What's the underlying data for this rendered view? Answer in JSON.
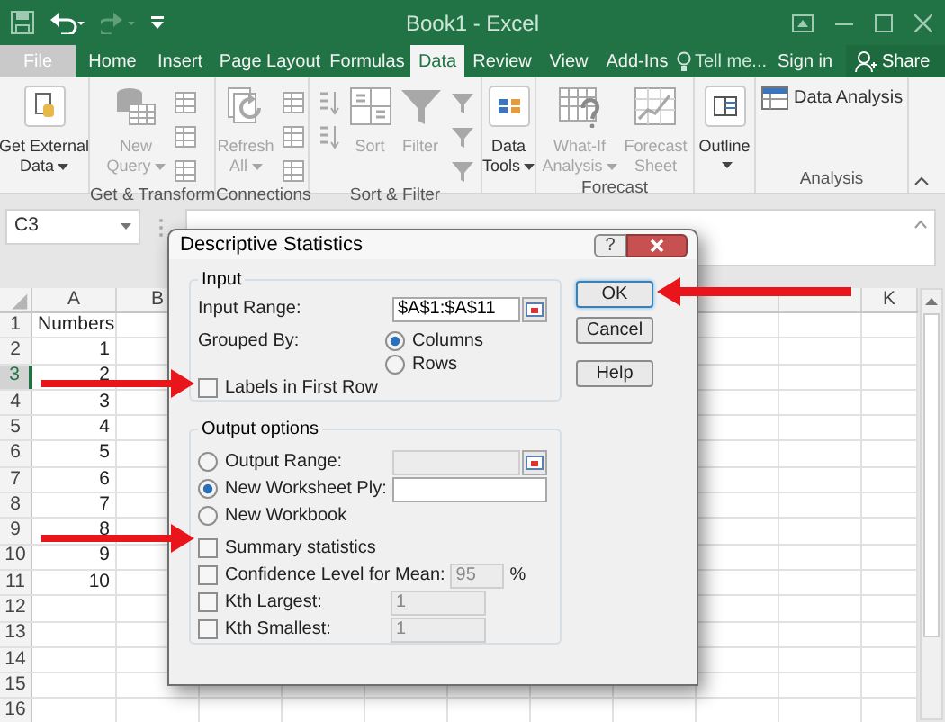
{
  "window": {
    "title": "Book1 - Excel"
  },
  "tabs": [
    {
      "label": "File",
      "selected": false,
      "kind": "file"
    },
    {
      "label": "Home",
      "selected": false
    },
    {
      "label": "Insert",
      "selected": false
    },
    {
      "label": "Page Layout",
      "selected": false
    },
    {
      "label": "Formulas",
      "selected": false
    },
    {
      "label": "Data",
      "selected": true
    },
    {
      "label": "Review",
      "selected": false
    },
    {
      "label": "View",
      "selected": false
    },
    {
      "label": "Add-Ins",
      "selected": false
    }
  ],
  "tell_me": "Tell me...",
  "sign_in": "Sign in",
  "share": "Share",
  "ribbon_groups": [
    {
      "buttons": [
        {
          "lines": [
            "Get External",
            "Data"
          ],
          "disabled": false,
          "dropdown": true
        }
      ]
    },
    {
      "label": "Get & Transform",
      "buttons": [
        {
          "lines": [
            "New",
            "Query"
          ],
          "disabled": true,
          "dropdown": true
        }
      ]
    },
    {
      "label": "Connections",
      "buttons": [
        {
          "lines": [
            "Refresh",
            "All"
          ],
          "disabled": true,
          "dropdown": true
        }
      ]
    },
    {
      "label": "Sort & Filter",
      "buttons": [
        {
          "lines": [
            "Sort"
          ],
          "disabled": true,
          "dropdown": false
        },
        {
          "lines": [
            "Filter"
          ],
          "disabled": true,
          "dropdown": false
        }
      ]
    },
    {
      "buttons": [
        {
          "lines": [
            "Data",
            "Tools"
          ],
          "disabled": false,
          "dropdown": true
        }
      ]
    },
    {
      "label": "Forecast",
      "buttons": [
        {
          "lines": [
            "What-If",
            "Analysis"
          ],
          "disabled": true,
          "dropdown": true
        },
        {
          "lines": [
            "Forecast",
            "Sheet"
          ],
          "disabled": true,
          "dropdown": false
        }
      ]
    },
    {
      "buttons": [
        {
          "lines": [
            "Outline"
          ],
          "disabled": false,
          "dropdown": true
        }
      ]
    },
    {
      "label": "Analysis",
      "buttons": [
        {
          "lines": [
            "Data Analysis"
          ],
          "disabled": false,
          "dropdown": false,
          "kind": "small"
        }
      ]
    }
  ],
  "sheet": {
    "name_box": "C3",
    "columns": [
      "A",
      "B"
    ],
    "right_columns": [
      "K"
    ],
    "rows": [
      {
        "header": "1",
        "selected": false,
        "cells": [
          {
            "value": "Numbers",
            "kind": "text"
          }
        ]
      },
      {
        "header": "2",
        "selected": false,
        "cells": [
          {
            "value": "1",
            "kind": "number"
          }
        ]
      },
      {
        "header": "3",
        "selected": true,
        "cells": [
          {
            "value": "2",
            "kind": "number"
          }
        ]
      },
      {
        "header": "4",
        "selected": false,
        "cells": [
          {
            "value": "3",
            "kind": "number"
          }
        ]
      },
      {
        "header": "5",
        "selected": false,
        "cells": [
          {
            "value": "4",
            "kind": "number"
          }
        ]
      },
      {
        "header": "6",
        "selected": false,
        "cells": [
          {
            "value": "5",
            "kind": "number"
          }
        ]
      },
      {
        "header": "7",
        "selected": false,
        "cells": [
          {
            "value": "6",
            "kind": "number"
          }
        ]
      },
      {
        "header": "8",
        "selected": false,
        "cells": [
          {
            "value": "7",
            "kind": "number"
          }
        ]
      },
      {
        "header": "9",
        "selected": false,
        "cells": [
          {
            "value": "8",
            "kind": "number"
          }
        ]
      },
      {
        "header": "10",
        "selected": false,
        "cells": [
          {
            "value": "9",
            "kind": "number"
          }
        ]
      },
      {
        "header": "11",
        "selected": false,
        "cells": [
          {
            "value": "10",
            "kind": "number"
          }
        ]
      },
      {
        "header": "12",
        "selected": false
      },
      {
        "header": "13",
        "selected": false
      },
      {
        "header": "14",
        "selected": false
      },
      {
        "header": "15",
        "selected": false
      },
      {
        "header": "16",
        "selected": false
      }
    ]
  },
  "dialog": {
    "title": "Descriptive Statistics",
    "help_glyph": "?",
    "input": {
      "legend": "Input",
      "range_label": "Input Range:",
      "range_value": "$A$1:$A$11",
      "grouped_label": "Grouped By:",
      "grouped_options": [
        {
          "label": "Columns",
          "selected": true
        },
        {
          "label": "Rows",
          "selected": false
        }
      ],
      "labels_checkbox": {
        "label": "Labels in First Row",
        "checked": false
      }
    },
    "output": {
      "legend": "Output options",
      "radios": [
        {
          "label": "Output Range:",
          "selected": false,
          "kind": "range_field",
          "disabled": true
        },
        {
          "label": "New Worksheet Ply:",
          "selected": true,
          "kind": "text_field",
          "disabled": false
        },
        {
          "label": "New Workbook",
          "selected": false
        }
      ],
      "checkboxes": [
        {
          "label": "Summary statistics",
          "checked": false
        },
        {
          "label": "Confidence Level for Mean:",
          "checked": false,
          "value": "95",
          "suffix": "%",
          "disabled": true
        },
        {
          "label": "Kth Largest:",
          "checked": false,
          "value": "1",
          "disabled": true
        },
        {
          "label": "Kth Smallest:",
          "checked": false,
          "value": "1",
          "disabled": true
        }
      ]
    },
    "buttons": [
      {
        "label": "OK",
        "focused": true
      },
      {
        "label": "Cancel",
        "focused": false
      },
      {
        "label": "Help",
        "focused": false
      }
    ]
  }
}
